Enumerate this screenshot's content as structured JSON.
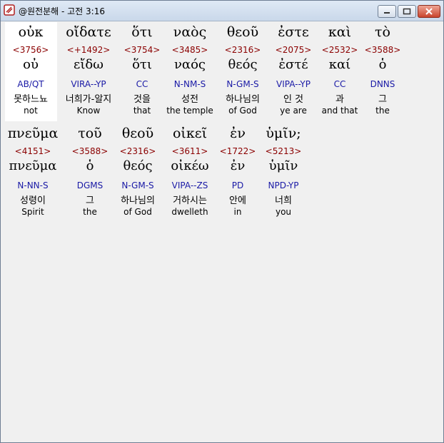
{
  "window": {
    "title": "@원전분해 - 고전 3:16"
  },
  "controls": {
    "minimize": "minimize",
    "maximize": "maximize",
    "close": "close"
  },
  "words": [
    {
      "greek": "οὐκ",
      "strong": "<3756>",
      "lemma": "οὐ",
      "morph": "AB/QT",
      "korean": "못하느뇨",
      "english": "not"
    },
    {
      "greek": "οἴδατε",
      "strong": "<+1492>",
      "lemma": "εἴδω",
      "morph": "VIRA--YP",
      "korean": "너희가-알지",
      "english": "Know"
    },
    {
      "greek": "ὅτι",
      "strong": "<3754>",
      "lemma": "ὅτι",
      "morph": "CC",
      "korean": "것을",
      "english": "that"
    },
    {
      "greek": "ναὸς",
      "strong": "<3485>",
      "lemma": "ναός",
      "morph": "N-NM-S",
      "korean": "성전",
      "english": "the temple"
    },
    {
      "greek": "θεοῦ",
      "strong": "<2316>",
      "lemma": "θεός",
      "morph": "N-GM-S",
      "korean": "하나님의",
      "english": "of God"
    },
    {
      "greek": "ἐστε",
      "strong": "<2075>",
      "lemma": "ἐστέ",
      "morph": "VIPA--YP",
      "korean": "인 것",
      "english": "ye are"
    },
    {
      "greek": "καὶ",
      "strong": "<2532>",
      "lemma": "καί",
      "morph": "CC",
      "korean": "과",
      "english": "and that"
    },
    {
      "greek": "τὸ",
      "strong": "<3588>",
      "lemma": "ὁ",
      "morph": "DNNS",
      "korean": "그",
      "english": "the"
    },
    {
      "greek": "πνεῦμα",
      "strong": "<4151>",
      "lemma": "πνεῦμα",
      "morph": "N-NN-S",
      "korean": "성령이",
      "english": "Spirit"
    },
    {
      "greek": "τοῦ",
      "strong": "<3588>",
      "lemma": "ὁ",
      "morph": "DGMS",
      "korean": "그",
      "english": "the"
    },
    {
      "greek": "θεοῦ",
      "strong": "<2316>",
      "lemma": "θεός",
      "morph": "N-GM-S",
      "korean": "하나님의",
      "english": "of God"
    },
    {
      "greek": "οἰκεῖ",
      "strong": "<3611>",
      "lemma": "οἰκέω",
      "morph": "VIPA--ZS",
      "korean": "거하시는",
      "english": "dwelleth"
    },
    {
      "greek": "ἐν",
      "strong": "<1722>",
      "lemma": "ἐν",
      "morph": "PD",
      "korean": "안에",
      "english": "in"
    },
    {
      "greek": "ὑμῖν;",
      "strong": "<5213>",
      "lemma": "ὑμῖν",
      "morph": "NPD-YP",
      "korean": "너희",
      "english": "you"
    }
  ]
}
